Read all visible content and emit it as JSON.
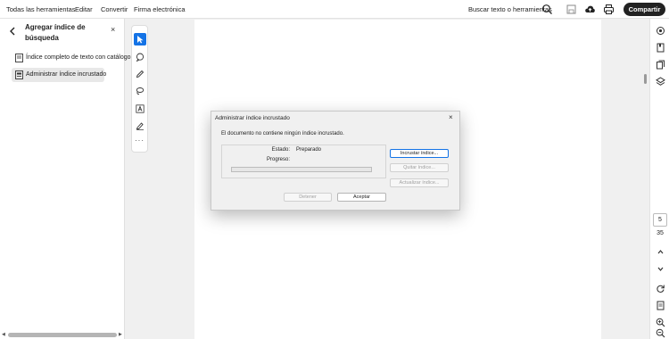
{
  "menubar": {
    "items": [
      "Todas las herramientas",
      "Editar",
      "Convertir",
      "Firma electrónica"
    ],
    "search_label": "Buscar texto o herramientas",
    "share_label": "Compartir"
  },
  "left_panel": {
    "title": "Agregar índice de búsqueda",
    "close_glyph": "×",
    "items": [
      {
        "label": "Índice completo de texto con catálogo",
        "icon": "catalog-icon",
        "active": false
      },
      {
        "label": "Administrar índice incrustado",
        "icon": "embedded-index-icon",
        "active": true
      }
    ]
  },
  "tools": [
    "select-cursor-icon",
    "comment-icon",
    "pen-icon",
    "lasso-icon",
    "text-box-icon",
    "fill-sign-icon"
  ],
  "tools_more": "···",
  "right_rail": {
    "current_page": "5",
    "total_pages": "35"
  },
  "dialog": {
    "title": "Administrar índice incrustado",
    "close_glyph": "×",
    "message": "El documento no contiene ningún índice incrustado.",
    "status_label": "Estado:",
    "status_value": "Preparado",
    "progress_label": "Progreso:",
    "progress": 0,
    "embed_button": "Incrustar índice...",
    "remove_button": "Quitar índice...",
    "update_button": "Actualizar índice...",
    "stop_button": "Detener",
    "accept_button": "Aceptar"
  },
  "colors": {
    "accent": "#1473e6",
    "share_button": "#222222",
    "page_bg": "#f0f0f0"
  }
}
